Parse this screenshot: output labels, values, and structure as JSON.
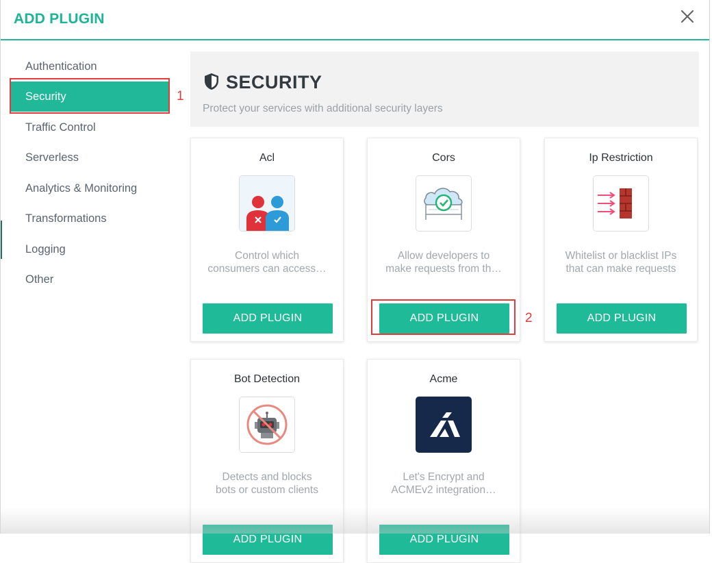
{
  "modal": {
    "title": "ADD PLUGIN"
  },
  "sidebar": {
    "items": [
      {
        "label": "Authentication"
      },
      {
        "label": "Security"
      },
      {
        "label": "Traffic Control"
      },
      {
        "label": "Serverless"
      },
      {
        "label": "Analytics & Monitoring"
      },
      {
        "label": "Transformations"
      },
      {
        "label": "Logging"
      },
      {
        "label": "Other"
      }
    ],
    "active_index": 1
  },
  "annotations": {
    "marker_1": "1",
    "marker_2": "2"
  },
  "section": {
    "title": "SECURITY",
    "subtitle": "Protect your services with additional security layers",
    "icon": "shield-icon"
  },
  "plugins": [
    {
      "name": "Acl",
      "desc1": "Control which",
      "desc2": "consumers can access…",
      "button": "ADD PLUGIN",
      "icon": "acl-users-icon"
    },
    {
      "name": "Cors",
      "desc1": "Allow developers to",
      "desc2": "make requests from th…",
      "button": "ADD PLUGIN",
      "icon": "cors-cloud-icon"
    },
    {
      "name": "Ip Restriction",
      "desc1": "Whitelist or blacklist IPs",
      "desc2": "that can make requests",
      "button": "ADD PLUGIN",
      "icon": "ip-firewall-icon"
    },
    {
      "name": "Bot Detection",
      "desc1": "Detects and blocks",
      "desc2": "bots or custom clients",
      "button": "ADD PLUGIN",
      "icon": "bot-block-icon"
    },
    {
      "name": "Acme",
      "desc1": "Let's Encrypt and",
      "desc2": "ACMEv2 integration…",
      "button": "ADD PLUGIN",
      "icon": "acme-logo-icon"
    }
  ],
  "colors": {
    "accent": "#1fba98",
    "annotation": "#e23b3b"
  }
}
